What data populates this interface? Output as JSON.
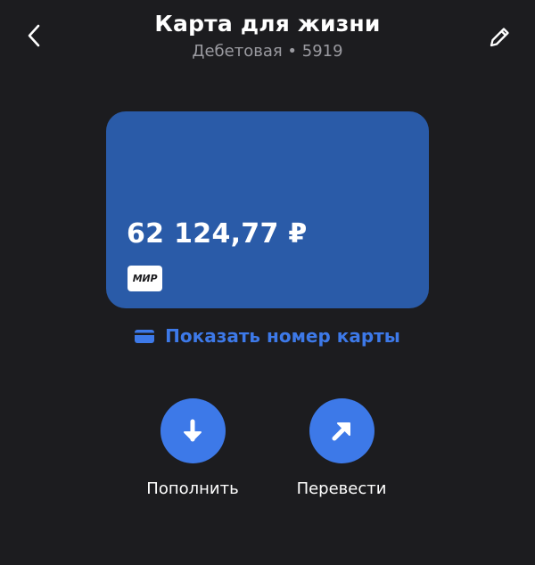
{
  "header": {
    "title": "Карта для жизни",
    "subtitle": "Дебетовая • 5919",
    "back_icon": "chevron-left-icon",
    "edit_icon": "pencil-icon"
  },
  "card": {
    "balance": "62 124,77 ₽",
    "payment_system": "МИР",
    "color": "#2a5ba8"
  },
  "show_number": {
    "label": "Показать номер карты",
    "icon": "card-icon",
    "color": "#3d79e8"
  },
  "actions": [
    {
      "label": "Пополнить",
      "icon": "arrow-down-icon"
    },
    {
      "label": "Перевести",
      "icon": "arrow-up-right-icon"
    }
  ],
  "colors": {
    "background": "#1c1c1f",
    "accent": "#3d79e8",
    "text_primary": "#ffffff",
    "text_secondary": "#9a9aa0"
  }
}
